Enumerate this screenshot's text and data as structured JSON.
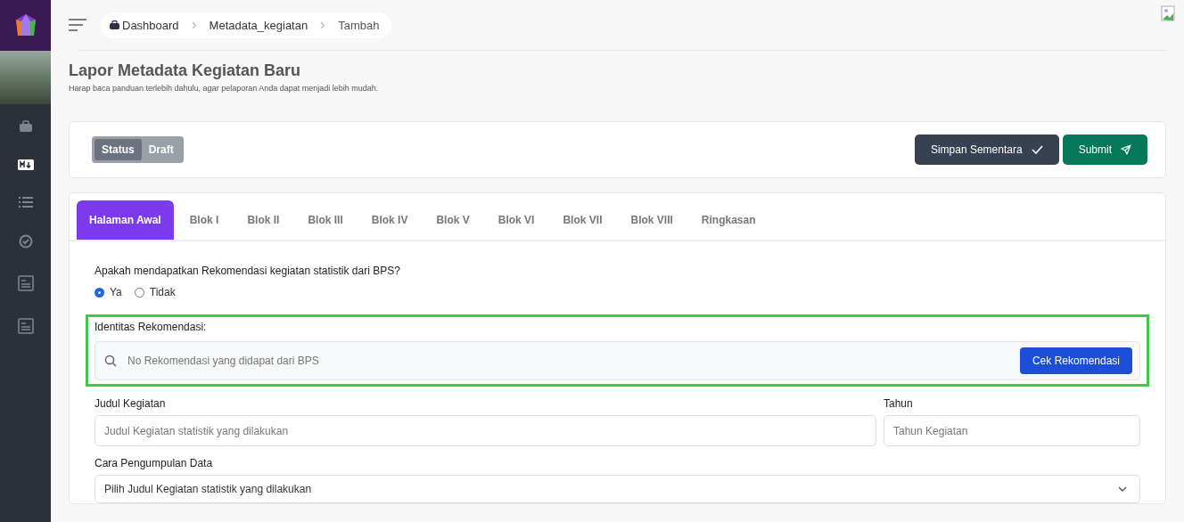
{
  "breadcrumb": [
    {
      "label": "Dashboard",
      "icon": true
    },
    {
      "label": "Metadata_kegiatan",
      "icon": false
    },
    {
      "label": "Tambah",
      "icon": false
    }
  ],
  "page": {
    "title": "Lapor Metadata Kegiatan Baru",
    "subtitle": "Harap baca panduan terlebih dahulu, agar pelaporan Anda dapat menjadi lebih mudah."
  },
  "status_toggle": [
    {
      "label": "Status",
      "selected": true
    },
    {
      "label": "Draft",
      "selected": false
    }
  ],
  "actions": [
    {
      "label": "Simpan Sementara",
      "kind": "save"
    },
    {
      "label": "Submit",
      "kind": "submit"
    }
  ],
  "tabs": [
    {
      "label": "Halaman Awal",
      "selected": true
    },
    {
      "label": "Blok I",
      "selected": false
    },
    {
      "label": "Blok II",
      "selected": false
    },
    {
      "label": "Blok III",
      "selected": false
    },
    {
      "label": "Blok IV",
      "selected": false
    },
    {
      "label": "Blok V",
      "selected": false
    },
    {
      "label": "Blok VI",
      "selected": false
    },
    {
      "label": "Blok VII",
      "selected": false
    },
    {
      "label": "Blok VIII",
      "selected": false
    },
    {
      "label": "Ringkasan",
      "selected": false
    }
  ],
  "question": {
    "label": "Apakah mendapatkan Rekomendasi kegiatan statistik dari BPS?",
    "options": [
      {
        "label": "Ya",
        "selected": true
      },
      {
        "label": "Tidak",
        "selected": false
      }
    ]
  },
  "rekomendasi": {
    "label": "Identitas Rekomendasi:",
    "placeholder": "No Rekomendasi yang didapat dari BPS",
    "button": "Cek Rekomendasi"
  },
  "judul": {
    "label": "Judul Kegiatan",
    "placeholder": "Judul Kegiatan statistik yang dilakukan"
  },
  "tahun": {
    "label": "Tahun",
    "placeholder": "Tahun Kegiatan"
  },
  "cara": {
    "label": "Cara Pengumpulan Data",
    "placeholder": "Pilih Judul Kegiatan statistik yang dilakukan"
  }
}
